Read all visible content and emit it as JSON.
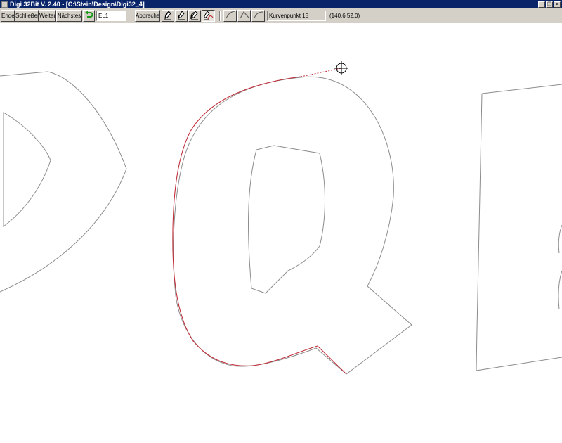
{
  "window": {
    "title": "Digi 32Bit  V. 2.40 - [C:\\Stein\\Design\\Digi32_4]"
  },
  "toolbar": {
    "ende": "Ende",
    "schliessen": "Schließen",
    "weiter": "Weiter",
    "naechstes": "Nächstes",
    "layer_value": "EL1",
    "abbrechen": "Abbrechen",
    "status": "Kurvenpunkt 15",
    "coords": "(140,6  52,0)"
  },
  "colors": {
    "titlebar": "#0a246a",
    "chrome": "#d4d0c8",
    "outline": "#8c8c8c",
    "trace": "#c0303a",
    "undo_icon": "#1a9b1a"
  },
  "icons": {
    "undo": "green-undo-arrow-icon",
    "digitize": [
      "pen-curve-icon",
      "pen-line-icon",
      "pen-arc-icon",
      "pen-active-icon"
    ],
    "curve_modes": [
      "curve-rise-icon",
      "curve-peak-icon",
      "curve-concave-icon"
    ],
    "cursor": "crosshair-icon"
  }
}
